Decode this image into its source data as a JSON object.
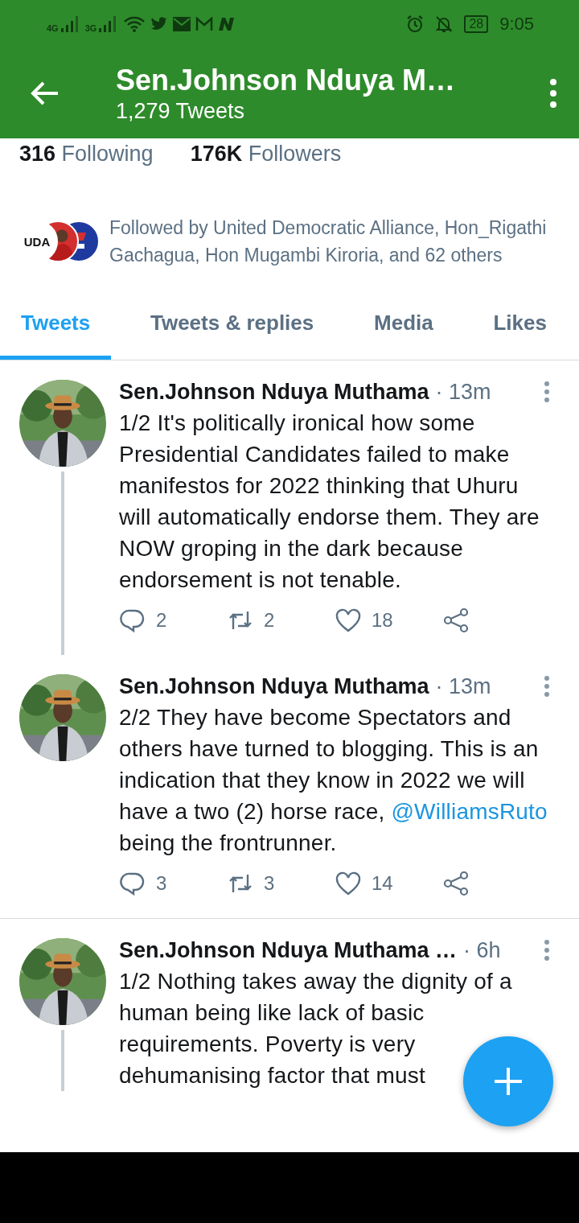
{
  "status_bar": {
    "network_1": "4G",
    "network_2": "3G",
    "battery": "28",
    "time": "9:05"
  },
  "header": {
    "title": "Sen.Johnson Nduya M…",
    "subtitle": "1,279 Tweets"
  },
  "stats": [
    {
      "count": "316",
      "label": "Following"
    },
    {
      "count": "176K",
      "label": "Followers"
    }
  ],
  "followed_by": "Followed by United Democratic Alliance, Hon_Rigathi Gachagua, Hon Mugambi Kiroria, and 62 others",
  "avatars": [
    {
      "kind": "badge",
      "text": "UDA",
      "color": "#ffffff"
    },
    {
      "kind": "picture",
      "color": "#d32f2f"
    },
    {
      "kind": "badge",
      "color": "#1e3a9e"
    }
  ],
  "tabs": [
    {
      "label": "Tweets",
      "selected": true
    },
    {
      "label": "Tweets & replies",
      "selected": false
    },
    {
      "label": "Media",
      "selected": false
    },
    {
      "label": "Likes",
      "selected": false
    }
  ],
  "tweets": [
    {
      "name": "Sen.Johnson Nduya Muthama",
      "time": "· 13m",
      "thread_line": true,
      "text": [
        {
          "kind": "text",
          "text": "1/2 It's politically ironical how some Presidential Candidates failed to make manifestos for 2022 thinking that Uhuru will automatically endorse them. They are NOW groping in the dark because endorsement is not tenable."
        }
      ],
      "replies": "2",
      "retweets": "2",
      "likes": "18"
    },
    {
      "name": "Sen.Johnson Nduya Muthama",
      "time": "· 13m",
      "thread_line": false,
      "text": [
        {
          "kind": "text",
          "text": "2/2 They have become Spectators and others have turned to blogging.  This is an indication that they know in 2022 we will have a two (2) horse race, "
        },
        {
          "kind": "mention",
          "text": "@WilliamsRuto"
        },
        {
          "kind": "text",
          "text": " being the frontrunner."
        }
      ],
      "replies": "3",
      "retweets": "3",
      "likes": "14"
    },
    {
      "name": "Sen.Johnson Nduya Muthama …",
      "time": "· 6h",
      "thread_line": true,
      "text": [
        {
          "kind": "text",
          "text": "1/2 Nothing takes away the dignity of a human being like lack of basic requirements. Poverty is very dehumanising factor that must"
        }
      ]
    }
  ]
}
